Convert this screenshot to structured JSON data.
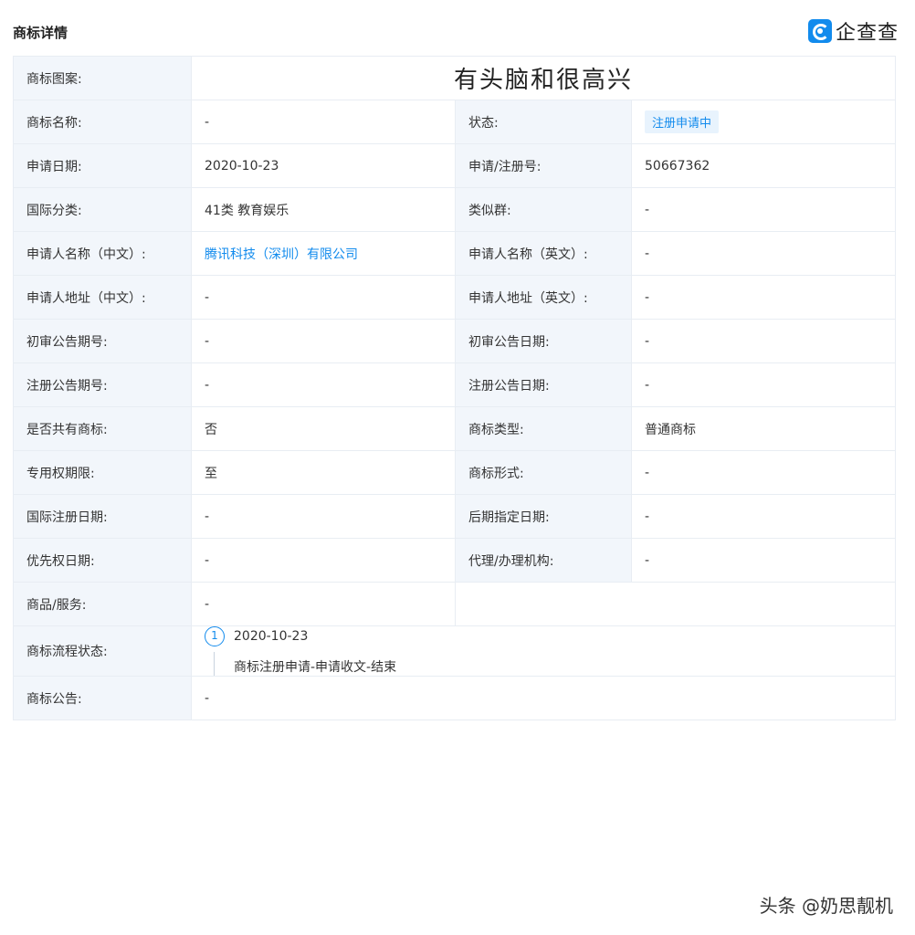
{
  "header": {
    "title": "商标详情",
    "brand": "企查查"
  },
  "image": {
    "label": "商标图案:",
    "text": "有头脑和很高兴"
  },
  "rows": {
    "name_label": "商标名称:",
    "name_value": "-",
    "status_label": "状态:",
    "status_value": "注册申请中",
    "apply_date_label": "申请日期:",
    "apply_date_value": "2020-10-23",
    "reg_no_label": "申请/注册号:",
    "reg_no_value": "50667362",
    "class_label": "国际分类:",
    "class_value": "41类 教育娱乐",
    "similar_label": "类似群:",
    "similar_value": "-",
    "applicant_cn_label": "申请人名称（中文）:",
    "applicant_cn_value": "腾讯科技（深圳）有限公司",
    "applicant_en_label": "申请人名称（英文）:",
    "applicant_en_value": "-",
    "addr_cn_label": "申请人地址（中文）:",
    "addr_cn_value": "-",
    "addr_en_label": "申请人地址（英文）:",
    "addr_en_value": "-",
    "prelim_no_label": "初审公告期号:",
    "prelim_no_value": "-",
    "prelim_date_label": "初审公告日期:",
    "prelim_date_value": "-",
    "reg_notice_no_label": "注册公告期号:",
    "reg_notice_no_value": "-",
    "reg_notice_date_label": "注册公告日期:",
    "reg_notice_date_value": "-",
    "shared_label": "是否共有商标:",
    "shared_value": "否",
    "type_label": "商标类型:",
    "type_value": "普通商标",
    "term_label": "专用权期限:",
    "term_value": "至",
    "form_label": "商标形式:",
    "form_value": "-",
    "intl_date_label": "国际注册日期:",
    "intl_date_value": "-",
    "later_date_label": "后期指定日期:",
    "later_date_value": "-",
    "priority_label": "优先权日期:",
    "priority_value": "-",
    "agent_label": "代理/办理机构:",
    "agent_value": "-",
    "goods_label": "商品/服务:",
    "goods_value": "-",
    "flow_label": "商标流程状态:",
    "flow_step": "1",
    "flow_date": "2020-10-23",
    "flow_desc": "商标注册申请-申请收文-结束",
    "notice_label": "商标公告:",
    "notice_value": "-"
  },
  "watermark": "头条 @奶思靓机",
  "colors": {
    "accent": "#128bed",
    "label_bg": "#f2f6fb",
    "border": "#e8edf3"
  }
}
